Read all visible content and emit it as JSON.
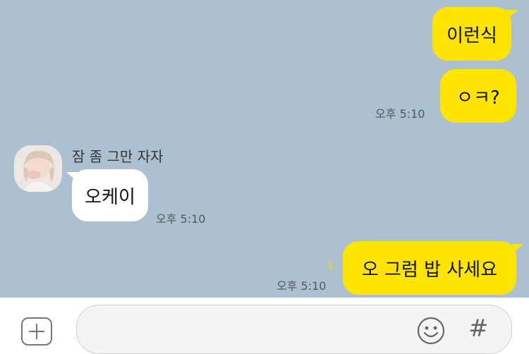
{
  "messages": [
    {
      "side": "me",
      "text": "이런식"
    },
    {
      "side": "me",
      "text": "ㅇㅋ?",
      "time": "오후 5:10"
    },
    {
      "side": "other",
      "sender": "잠 좀 그만 자자",
      "text": "오케이",
      "time": "오후 5:10"
    },
    {
      "side": "me",
      "text": "오 그럼 밥 사세요",
      "time": "오후 5:10",
      "unread_count": "1"
    }
  ],
  "colors": {
    "background": "#abc1d1",
    "my_bubble": "#fee500",
    "other_bubble": "#ffffff",
    "unread": "#f5d800"
  },
  "input_bar": {
    "plus_icon": "plus-icon",
    "emoji_icon": "emoji-icon",
    "hash_icon": "hashtag-icon",
    "hash_glyph": "#"
  }
}
